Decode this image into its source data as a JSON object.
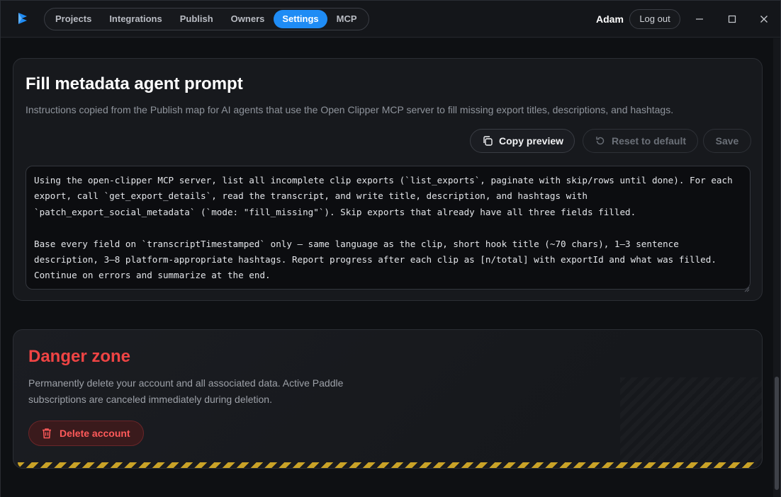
{
  "nav": {
    "items": [
      {
        "label": "Projects",
        "active": false
      },
      {
        "label": "Integrations",
        "active": false
      },
      {
        "label": "Publish",
        "active": false
      },
      {
        "label": "Owners",
        "active": false
      },
      {
        "label": "Settings",
        "active": true
      },
      {
        "label": "MCP",
        "active": false
      }
    ]
  },
  "user": {
    "name": "Adam",
    "logout_label": "Log out"
  },
  "prompt_card": {
    "title": "Fill metadata agent prompt",
    "description": "Instructions copied from the Publish map for AI agents that use the Open Clipper MCP server to fill missing export titles, descriptions, and hashtags.",
    "copy_label": "Copy preview",
    "reset_label": "Reset to default",
    "save_label": "Save",
    "prompt_text": "Using the open-clipper MCP server, list all incomplete clip exports (`list_exports`, paginate with skip/rows until done). For each export, call `get_export_details`, read the transcript, and write title, description, and hashtags with `patch_export_social_metadata` (`mode: \"fill_missing\"`). Skip exports that already have all three fields filled.\n\nBase every field on `transcriptTimestamped` only — same language as the clip, short hook title (~70 chars), 1–3 sentence description, 3–8 platform-appropriate hashtags. Report progress after each clip as [n/total] with exportId and what was filled. Continue on errors and summarize at the end."
  },
  "danger_card": {
    "title": "Danger zone",
    "description": "Permanently delete your account and all associated data. Active Paddle subscriptions are canceled immediately during deletion.",
    "delete_label": "Delete account"
  },
  "colors": {
    "accent": "#1f8cf5",
    "danger": "#ef4444",
    "hazard_yellow": "#c9a227"
  },
  "icons": {
    "logo": "app-logo-icon",
    "minimize": "minimize-icon",
    "maximize": "maximize-icon",
    "close": "close-icon",
    "copy": "copy-icon",
    "reset": "reset-icon",
    "trash": "trash-icon"
  }
}
